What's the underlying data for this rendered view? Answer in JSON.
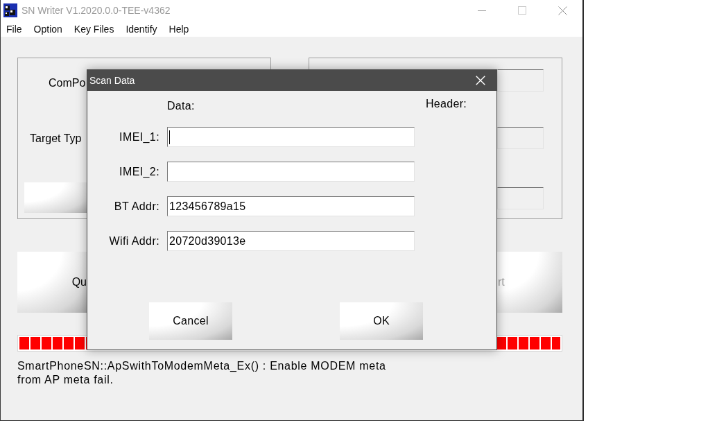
{
  "window": {
    "title": "SN Writer V1.2020.0.0-TEE-v4362"
  },
  "menu": [
    "File",
    "Option",
    "Key Files",
    "Identify",
    "Help"
  ],
  "left_group": {
    "labels": [
      "ComPo",
      "Target Typ"
    ]
  },
  "action_buttons": [
    {
      "label": "Qu",
      "disabled": false
    },
    {
      "label": "rt",
      "disabled": true
    }
  ],
  "progress": {
    "level": 1
  },
  "status_message": "SmartPhoneSN::ApSwithToModemMeta_Ex() : Enable MODEM meta from AP meta fail.",
  "dialog": {
    "title": "Scan Data",
    "columns": [
      "Data:",
      "Header:"
    ],
    "fields": [
      {
        "label": "IMEI_1:",
        "focused": true
      },
      {
        "label": "IMEI_2:",
        "focused": false
      },
      {
        "label": "BT Addr:",
        "value": "123456789a15",
        "focused": false
      },
      {
        "label": "Wifi Addr:",
        "value": "20720d39013e",
        "focused": false
      }
    ],
    "buttons": [
      "Cancel",
      "OK"
    ]
  }
}
